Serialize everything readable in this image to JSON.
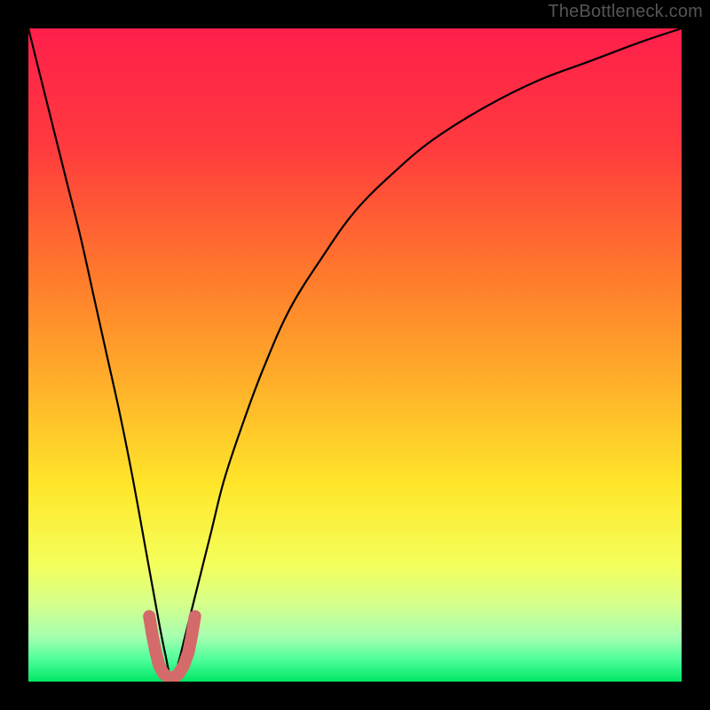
{
  "attribution": "TheBottleneck.com",
  "chart_data": {
    "type": "line",
    "title": "",
    "xlabel": "",
    "ylabel": "",
    "xlim": [
      0,
      100
    ],
    "ylim": [
      0,
      100
    ],
    "grid": false,
    "legend": false,
    "sweet_spot_x": 22,
    "gradient_stops": [
      {
        "pos": 0.0,
        "color": "#ff1f4b"
      },
      {
        "pos": 0.18,
        "color": "#ff3a3e"
      },
      {
        "pos": 0.38,
        "color": "#ff7a2c"
      },
      {
        "pos": 0.55,
        "color": "#ffb22a"
      },
      {
        "pos": 0.7,
        "color": "#ffe62a"
      },
      {
        "pos": 0.82,
        "color": "#f4ff5a"
      },
      {
        "pos": 0.88,
        "color": "#d6ff8a"
      },
      {
        "pos": 0.93,
        "color": "#a8ffb0"
      },
      {
        "pos": 0.965,
        "color": "#52ff9c"
      },
      {
        "pos": 1.0,
        "color": "#00e765"
      }
    ],
    "series": [
      {
        "name": "bottleneck-curve",
        "stroke": "#000000",
        "x": [
          0,
          2,
          4,
          6,
          8,
          10,
          12,
          14,
          16,
          18,
          20,
          21,
          22,
          23,
          24,
          26,
          28,
          30,
          33,
          36,
          40,
          45,
          50,
          56,
          62,
          70,
          78,
          86,
          94,
          100
        ],
        "y": [
          100,
          92,
          84,
          76,
          68,
          59,
          50,
          41,
          31,
          20,
          9,
          4,
          0,
          3,
          7,
          15,
          23,
          31,
          40,
          48,
          57,
          65,
          72,
          78,
          83,
          88,
          92,
          95,
          98,
          100
        ]
      },
      {
        "name": "sweet-spot-marker",
        "stroke": "#d46a6a",
        "x": [
          18.5,
          19.0,
          19.5,
          20.0,
          20.7,
          21.5,
          22.3,
          23.0,
          23.8,
          24.5,
          25.0,
          25.5
        ],
        "y": [
          10.0,
          7.0,
          4.5,
          2.5,
          1.2,
          0.6,
          0.6,
          1.2,
          2.5,
          4.5,
          7.0,
          10.0
        ]
      }
    ]
  }
}
